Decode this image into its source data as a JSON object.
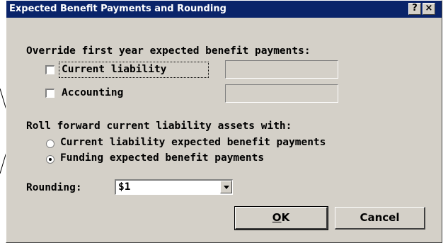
{
  "window": {
    "title": "Expected Benefit Payments and Rounding",
    "help_glyph": "?",
    "close_glyph": "×"
  },
  "override": {
    "heading": "Override first year expected benefit payments:",
    "current_liability": {
      "label": "Current liability",
      "checked": false,
      "value": ""
    },
    "accounting": {
      "label": "Accounting",
      "checked": false,
      "value": ""
    }
  },
  "roll_forward": {
    "heading": "Roll forward current liability assets with:",
    "options": [
      {
        "label": "Current liability expected benefit payments",
        "selected": false
      },
      {
        "label": "Funding expected benefit payments",
        "selected": true
      }
    ]
  },
  "rounding": {
    "label": "Rounding:",
    "selected": "$1"
  },
  "buttons": {
    "ok_mnemonic": "O",
    "ok_rest": "K",
    "cancel": "Cancel"
  },
  "icons": {
    "checkbox": "checkbox-icon",
    "radio": "radio-icon",
    "dropdown": "chevron-down-icon",
    "help": "help-icon",
    "close": "close-icon"
  }
}
